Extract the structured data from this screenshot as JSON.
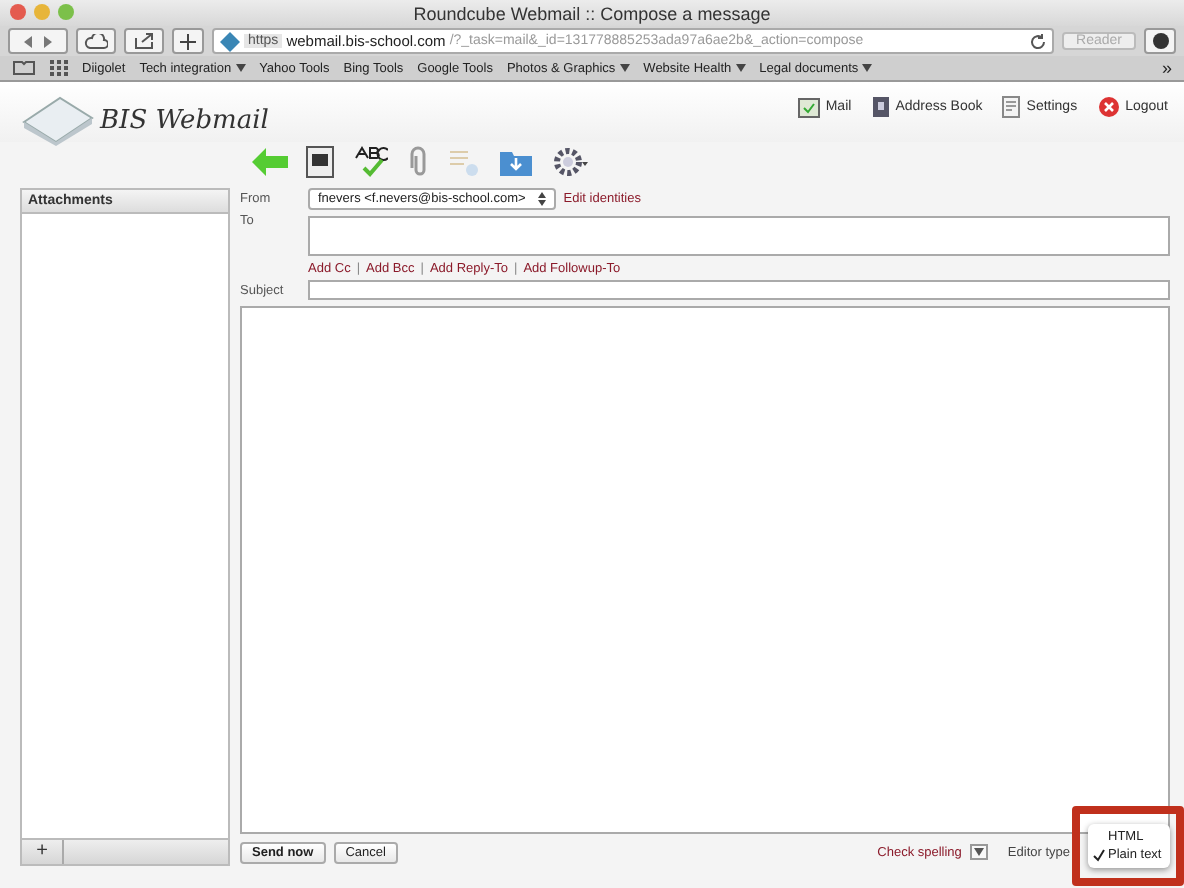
{
  "browser": {
    "title": "Roundcube Webmail :: Compose a message",
    "scheme": "https",
    "host": "webmail.bis-school.com",
    "path": "/?_task=mail&_id=131778885253ada97a6ae2b&_action=compose",
    "reader": "Reader",
    "bookmarks": [
      {
        "label": "Diigolet",
        "menu": false
      },
      {
        "label": "Tech integration",
        "menu": true
      },
      {
        "label": "Yahoo Tools",
        "menu": false
      },
      {
        "label": "Bing Tools",
        "menu": false
      },
      {
        "label": "Google Tools",
        "menu": false
      },
      {
        "label": "Photos & Graphics",
        "menu": true
      },
      {
        "label": "Website Health",
        "menu": true
      },
      {
        "label": "Legal documents",
        "menu": true
      }
    ],
    "more": "»"
  },
  "header": {
    "app_name": "BIS Webmail",
    "nav": [
      {
        "label": "Mail",
        "kind": "mail"
      },
      {
        "label": "Address Book",
        "kind": "book"
      },
      {
        "label": "Settings",
        "kind": "settings"
      },
      {
        "label": "Logout",
        "kind": "logout"
      }
    ]
  },
  "attachments": {
    "title": "Attachments",
    "add": "+"
  },
  "form": {
    "from_label": "From",
    "from_value": "fnevers <f.nevers@bis-school.com>",
    "edit_identities": "Edit identities",
    "to_label": "To",
    "add_links": [
      "Add Cc",
      "Add Bcc",
      "Add Reply-To",
      "Add Followup-To"
    ],
    "separator": "|",
    "subject_label": "Subject"
  },
  "footer": {
    "send": "Send now",
    "cancel": "Cancel",
    "check_spelling": "Check spelling",
    "editor_type": "Editor type",
    "menu": [
      {
        "label": "HTML",
        "selected": false
      },
      {
        "label": "Plain text",
        "selected": true
      }
    ]
  }
}
